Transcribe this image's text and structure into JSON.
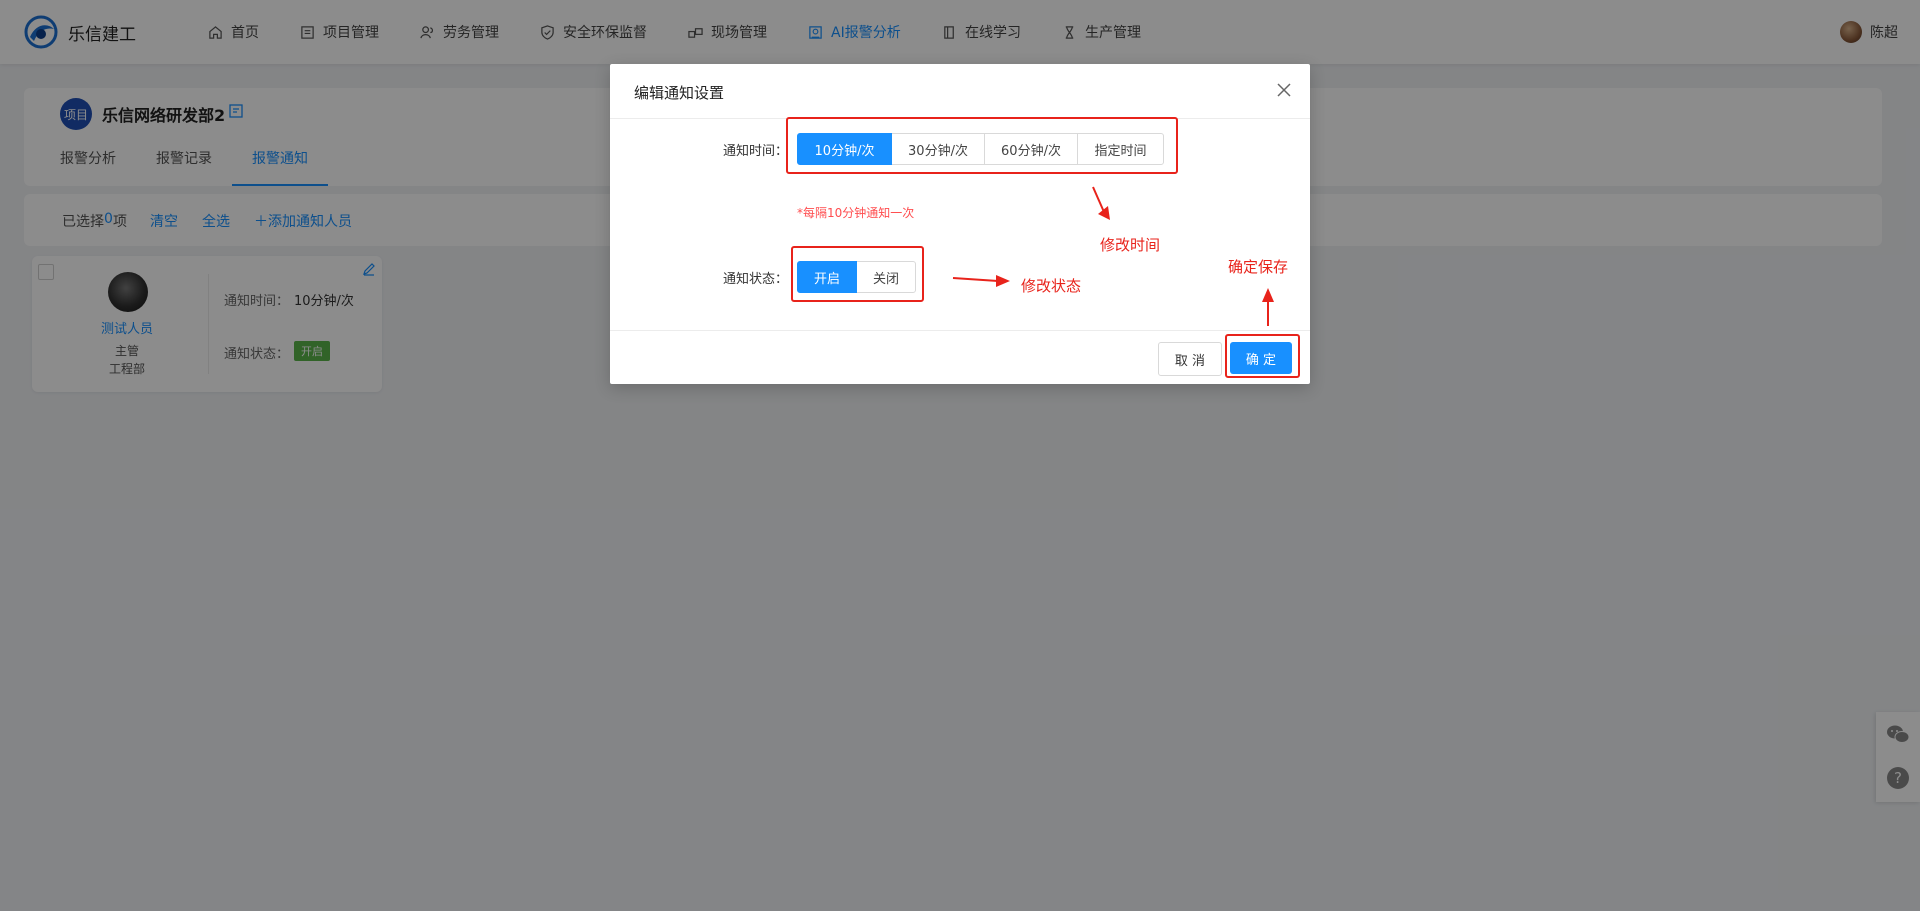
{
  "brand": {
    "name": "乐信建工"
  },
  "nav": [
    {
      "label": "首页",
      "icon": "home-icon"
    },
    {
      "label": "项目管理",
      "icon": "project-icon"
    },
    {
      "label": "劳务管理",
      "icon": "people-icon"
    },
    {
      "label": "安全环保监督",
      "icon": "shield-icon"
    },
    {
      "label": "现场管理",
      "icon": "site-icon"
    },
    {
      "label": "AI报警分析",
      "icon": "ai-icon",
      "active": true
    },
    {
      "label": "在线学习",
      "icon": "book-icon"
    },
    {
      "label": "生产管理",
      "icon": "hourglass-icon"
    }
  ],
  "user": {
    "name": "陈超"
  },
  "project": {
    "badge": "项目",
    "title": "乐信网络研发部2"
  },
  "tabs": [
    {
      "label": "报警分析"
    },
    {
      "label": "报警记录"
    },
    {
      "label": "报警通知",
      "active": true
    }
  ],
  "toolbar": {
    "selected_prefix": "已选择",
    "selected_count": "0",
    "selected_suffix": "项",
    "clear": "清空",
    "select_all": "全选",
    "add": "添加通知人员"
  },
  "person": {
    "name": "测试人员",
    "role": "主管",
    "dept": "工程部",
    "time_label": "通知时间：",
    "time_value": "10分钟/次",
    "status_label": "通知状态：",
    "status_value": "开启"
  },
  "modal": {
    "title": "编辑通知设置",
    "time_label": "通知时间：",
    "time_options": [
      "10分钟/次",
      "30分钟/次",
      "60分钟/次",
      "指定时间"
    ],
    "time_selected": 0,
    "hint": "*每隔10分钟通知一次",
    "status_label": "通知状态：",
    "status_options": [
      "开启",
      "关闭"
    ],
    "status_selected": 0,
    "cancel": "取 消",
    "ok": "确 定"
  },
  "annotations": {
    "time": "修改时间",
    "status": "修改状态",
    "save": "确定保存",
    "color": "#e8231b"
  },
  "colors": {
    "primary": "#1890ff",
    "tag_green": "#5ab54a",
    "hint_red": "#ff4d4f"
  }
}
